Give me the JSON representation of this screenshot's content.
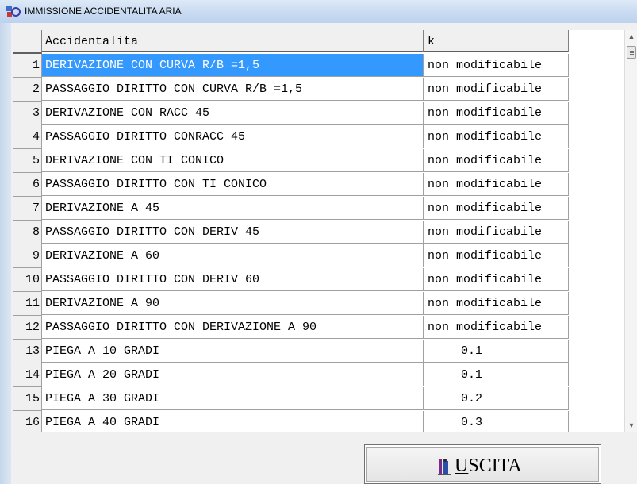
{
  "window": {
    "title": "IMMISSIONE ACCIDENTALITA ARIA"
  },
  "grid": {
    "columns": [
      "Accidentalita",
      "k"
    ],
    "rows": [
      {
        "num": "1",
        "name": "DERIVAZIONE CON CURVA R/B =1,5",
        "k": "non modificabile",
        "selected": true
      },
      {
        "num": "2",
        "name": "PASSAGGIO DIRITTO CON CURVA R/B =1,5",
        "k": "non modificabile"
      },
      {
        "num": "3",
        "name": "DERIVAZIONE CON RACC 45",
        "k": "non modificabile"
      },
      {
        "num": "4",
        "name": "PASSAGGIO DIRITTO CONRACC 45",
        "k": "non modificabile"
      },
      {
        "num": "5",
        "name": "DERIVAZIONE CON TI CONICO",
        "k": "non modificabile"
      },
      {
        "num": "6",
        "name": "PASSAGGIO DIRITTO CON TI CONICO",
        "k": "non modificabile"
      },
      {
        "num": "7",
        "name": "DERIVAZIONE A 45",
        "k": "non modificabile"
      },
      {
        "num": "8",
        "name": "PASSAGGIO DIRITTO CON DERIV 45",
        "k": "non modificabile"
      },
      {
        "num": "9",
        "name": "DERIVAZIONE A 60",
        "k": "non modificabile"
      },
      {
        "num": "10",
        "name": "PASSAGGIO DIRITTO CON DERIV 60",
        "k": "non modificabile"
      },
      {
        "num": "11",
        "name": "DERIVAZIONE A 90",
        "k": "non modificabile"
      },
      {
        "num": "12",
        "name": "PASSAGGIO DIRITTO CON DERIVAZIONE A 90",
        "k": "non modificabile"
      },
      {
        "num": "13",
        "name": "PIEGA A 10 GRADI",
        "k": "0.1",
        "numeric": true
      },
      {
        "num": "14",
        "name": "PIEGA A 20 GRADI",
        "k": "0.1",
        "numeric": true
      },
      {
        "num": "15",
        "name": "PIEGA A 30 GRADI",
        "k": "0.2",
        "numeric": true
      },
      {
        "num": "16",
        "name": "PIEGA A 40 GRADI",
        "k": "0.3",
        "numeric": true
      }
    ]
  },
  "exit_button": {
    "accel": "U",
    "rest": "SCITA"
  },
  "colors": {
    "selection": "#3399ff",
    "titlebar": "#c7daf1"
  }
}
